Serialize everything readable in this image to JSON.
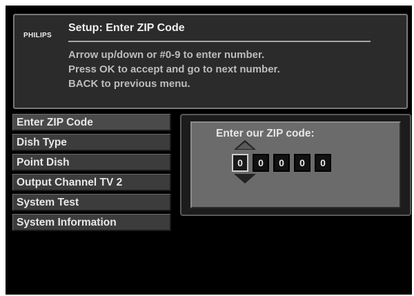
{
  "header": {
    "brand": "PHILIPS",
    "title": "Setup: Enter ZIP Code",
    "instructions": [
      "Arrow up/down or #0-9 to enter number.",
      "Press OK to accept and go to next number.",
      "BACK to previous menu."
    ]
  },
  "menu": {
    "items": [
      {
        "label": "Enter ZIP Code"
      },
      {
        "label": "Dish Type"
      },
      {
        "label": "Point Dish"
      },
      {
        "label": "Output Channel TV 2"
      },
      {
        "label": "System Test"
      },
      {
        "label": "System Information"
      }
    ],
    "selected": "Enter ZIP Code"
  },
  "zip": {
    "label": "Enter our ZIP code:",
    "digits": [
      "0",
      "0",
      "0",
      "0",
      "0"
    ],
    "active_digit_index": 0
  },
  "icons": {
    "up": "arrow-up-icon",
    "down": "arrow-down-icon"
  },
  "colors": {
    "background": "#000000",
    "panel": "#2b2b2b",
    "zip_panel": "#6b6b6b",
    "text": "#e8e8e8"
  }
}
